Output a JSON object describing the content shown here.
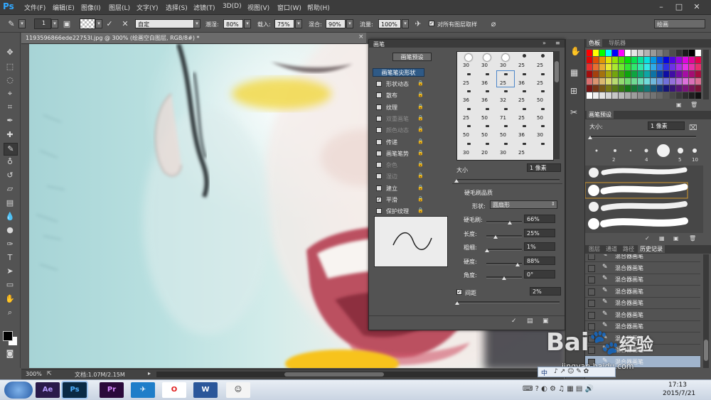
{
  "app": {
    "logo": "Ps"
  },
  "menu": [
    "文件(F)",
    "编辑(E)",
    "图像(I)",
    "图层(L)",
    "文字(Y)",
    "选择(S)",
    "滤镜(T)",
    "3D(D)",
    "视图(V)",
    "窗口(W)",
    "帮助(H)"
  ],
  "options": {
    "brush_size": "1",
    "preset": "自定",
    "wet_label": "潮湿:",
    "wet_value": "80%",
    "load_label": "载入:",
    "load_value": "75%",
    "mix_label": "混合:",
    "mix_value": "90%",
    "flow_label": "流量:",
    "flow_value": "100%",
    "sample_all_label": "对所有图层取样",
    "workspace": "绘画"
  },
  "document": {
    "title": "1193596866ede22753l.jpg @ 300% (绘画空白图层, RGB/8#) *",
    "zoom": "300%",
    "doc_info": "文档:1.07M/2.15M"
  },
  "brush_panel": {
    "title": "画笔",
    "presets_button": "画笔预设",
    "tip_shape_button": "画笔笔尖形状",
    "items": [
      {
        "label": "形状动态",
        "checked": false,
        "disabled": false
      },
      {
        "label": "散布",
        "checked": false,
        "disabled": false
      },
      {
        "label": "纹理",
        "checked": false,
        "disabled": false
      },
      {
        "label": "双重画笔",
        "checked": false,
        "disabled": true
      },
      {
        "label": "颜色动态",
        "checked": false,
        "disabled": true
      },
      {
        "label": "传递",
        "checked": false,
        "disabled": false
      },
      {
        "label": "画笔笔势",
        "checked": false,
        "disabled": false
      },
      {
        "label": "杂色",
        "checked": false,
        "disabled": true
      },
      {
        "label": "湿边",
        "checked": false,
        "disabled": true
      },
      {
        "label": "建立",
        "checked": false,
        "disabled": false
      },
      {
        "label": "平滑",
        "checked": true,
        "disabled": false
      },
      {
        "label": "保护纹理",
        "checked": false,
        "disabled": false
      }
    ],
    "tip_sizes": [
      [
        "30",
        "30",
        "30",
        "25",
        "25"
      ],
      [
        "25",
        "36",
        "25",
        "36",
        "25"
      ],
      [
        "36",
        "36",
        "32",
        "25",
        "50"
      ],
      [
        "25",
        "50",
        "71",
        "25",
        "50"
      ],
      [
        "50",
        "50",
        "50",
        "36",
        "30"
      ],
      [
        "30",
        "20",
        "30",
        "25",
        ""
      ]
    ],
    "size_label": "大小",
    "size_value": "1 像素",
    "bristle_title": "硬毛刷品质",
    "shape_label": "形状:",
    "shape_value": "圆扇形",
    "params": [
      {
        "label": "硬毛刷:",
        "value": "66%",
        "pos": 0.66
      },
      {
        "label": "长度:",
        "value": "25%",
        "pos": 0.25
      },
      {
        "label": "粗细:",
        "value": "1%",
        "pos": 0.01
      },
      {
        "label": "硬度:",
        "value": "88%",
        "pos": 0.88
      },
      {
        "label": "角度:",
        "value": "0°",
        "pos": 0.5
      }
    ],
    "spacing_label": "间距",
    "spacing_value": "2%"
  },
  "swatches_panel": {
    "tab_active": "色板",
    "tab_other": "导航器"
  },
  "brush_presets_panel": {
    "tab": "画笔预设",
    "size_label": "大小:",
    "size_value": "1 像素",
    "tip_numbers": [
      "2",
      "4",
      "5",
      "10"
    ]
  },
  "history_panel": {
    "tabs": [
      "图层",
      "通道",
      "路径",
      "历史记录"
    ],
    "rows": [
      "混合器画笔",
      "混合器画笔",
      "混合器画笔",
      "混合器画笔",
      "混合器画笔",
      "混合器画笔",
      "混合器画笔",
      "混合器画笔",
      "混合器画笔",
      "混合器画笔"
    ]
  },
  "taskbar": {
    "apps": [
      {
        "name": "Ae",
        "color": "#2a1a4a",
        "text": "#b69cff"
      },
      {
        "name": "Ps",
        "color": "#0a2a44",
        "text": "#4fb0ff"
      },
      {
        "name": "Pr",
        "color": "#2a0a3a",
        "text": "#d78bff"
      },
      {
        "name": "✈",
        "color": "#1f7ec9",
        "text": "#ffffff"
      },
      {
        "name": "O",
        "color": "#ffffff",
        "text": "#e01a1a"
      },
      {
        "name": "W",
        "color": "#2b579a",
        "text": "#ffffff"
      },
      {
        "name": "☺",
        "color": "#f4f4f4",
        "text": "#222222"
      }
    ],
    "ime": "中",
    "time": "17:13",
    "date": "2015/7/21"
  },
  "watermark": {
    "brand": "Bai",
    "sub": "经验",
    "url": "jingyan.baidu.com"
  },
  "colors": {
    "accent": "#31a8ff",
    "panel": "#535353",
    "panel_dark": "#3b3b3b"
  }
}
